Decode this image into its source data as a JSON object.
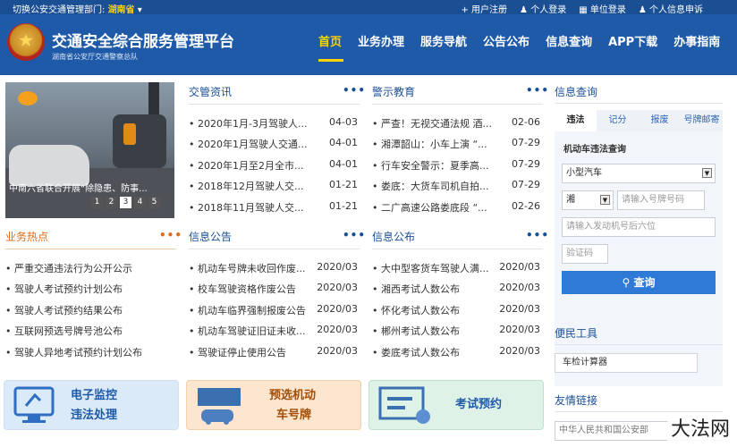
{
  "topbar": {
    "switch_label": "切换公安交通管理部门:",
    "province": "湖南省",
    "links": [
      {
        "icon": "plus-icon",
        "label": "用户注册"
      },
      {
        "icon": "user-icon",
        "label": "个人登录"
      },
      {
        "icon": "building-icon",
        "label": "单位登录"
      },
      {
        "icon": "user-icon",
        "label": "个人信息申诉"
      }
    ]
  },
  "header": {
    "title": "交通安全综合服务管理平台",
    "subtitle": "湖南省公安厅交通警察总队",
    "nav": [
      "首页",
      "业务办理",
      "服务导航",
      "公告公布",
      "信息查询",
      "APP下载",
      "办事指南"
    ],
    "nav_active": 0,
    "colors": {
      "primary": "#1f5aa8",
      "accent": "#ffd400"
    }
  },
  "banner": {
    "caption": "中南六省联合开展“除隐患、防事...",
    "pages": [
      "1",
      "2",
      "3",
      "4",
      "5"
    ],
    "active_page": "3"
  },
  "traffic_news": {
    "title": "交管资讯",
    "more": "•••",
    "items": [
      {
        "text": "• 2020年1月-3月驾驶人...",
        "date": "04-03"
      },
      {
        "text": "• 2020年1月驾驶人交通...",
        "date": "04-01"
      },
      {
        "text": "• 2020年1月至2月全市...",
        "date": "04-01"
      },
      {
        "text": "• 2018年12月驾驶人交...",
        "date": "01-21"
      },
      {
        "text": "• 2018年11月驾驶人交...",
        "date": "01-21"
      }
    ]
  },
  "warning_edu": {
    "title": "警示教育",
    "more": "•••",
    "items": [
      {
        "text": "• 严查！无视交通法规 酒...",
        "date": "02-06"
      },
      {
        "text": "• 湘潭韶山：小车上演 “...",
        "date": "07-29"
      },
      {
        "text": "• 行车安全警示：夏季高...",
        "date": "07-29"
      },
      {
        "text": "• 娄底：大货车司机自拍...",
        "date": "07-29"
      },
      {
        "text": "• 二广高速公路娄底段 “...",
        "date": "02-26"
      }
    ]
  },
  "hot_business": {
    "title": "业务热点",
    "more": "•••",
    "items": [
      {
        "text": "• 严重交通违法行为公开公示"
      },
      {
        "text": "• 驾驶人考试预约计划公布"
      },
      {
        "text": "• 驾驶人考试预约结果公布"
      },
      {
        "text": "• 互联网预选号牌号池公布"
      },
      {
        "text": "• 驾驶人异地考试预约计划公布"
      }
    ]
  },
  "info_notice": {
    "title": "信息公告",
    "more": "•••",
    "items": [
      {
        "text": "• 机动车号牌未收回作废...",
        "date": "2020/03"
      },
      {
        "text": "• 校车驾驶资格作废公告",
        "date": "2020/03"
      },
      {
        "text": "• 机动车临界强制报废公告",
        "date": "2020/03"
      },
      {
        "text": "• 机动车驾驶证旧证未收...",
        "date": "2020/03"
      },
      {
        "text": "• 驾驶证停止使用公告",
        "date": "2020/03"
      }
    ]
  },
  "info_publish": {
    "title": "信息公布",
    "more": "•••",
    "items": [
      {
        "text": "• 大中型客货车驾驶人满...",
        "date": "2020/03"
      },
      {
        "text": "• 湘西考试人数公布",
        "date": "2020/03"
      },
      {
        "text": "• 怀化考试人数公布",
        "date": "2020/03"
      },
      {
        "text": "• 郴州考试人数公布",
        "date": "2020/03"
      },
      {
        "text": "• 娄底考试人数公布",
        "date": "2020/03"
      }
    ]
  },
  "query": {
    "title": "信息查询",
    "tabs": [
      "违法",
      "记分",
      "报废",
      "号牌邮寄"
    ],
    "active_tab": 0,
    "box_title": "机动车违法查询",
    "vehicle_type": "小型汽车",
    "plate_prefix": "湘",
    "plate_placeholder": "请输入号牌号码",
    "engine_placeholder": "请输入发动机号后六位",
    "captcha_placeholder": "验证码",
    "submit_icon": "search-icon",
    "submit": "查询"
  },
  "tools": {
    "title": "便民工具",
    "calculator": "车检计算器"
  },
  "links": {
    "title": "友情链接",
    "first": "中华人民共和国公安部"
  },
  "quick": [
    {
      "icon": "monitor-icon",
      "line1": "电子监控",
      "line2": "违法处理",
      "color": "#dbeaf8"
    },
    {
      "icon": "plate-icon",
      "line1": "预选机动",
      "line2": "车号牌",
      "color": "#fde6cf"
    },
    {
      "icon": "calendar-icon",
      "line1": "考试预约",
      "line2": "",
      "color": "#dff2e8"
    }
  ],
  "watermark": "大法网"
}
